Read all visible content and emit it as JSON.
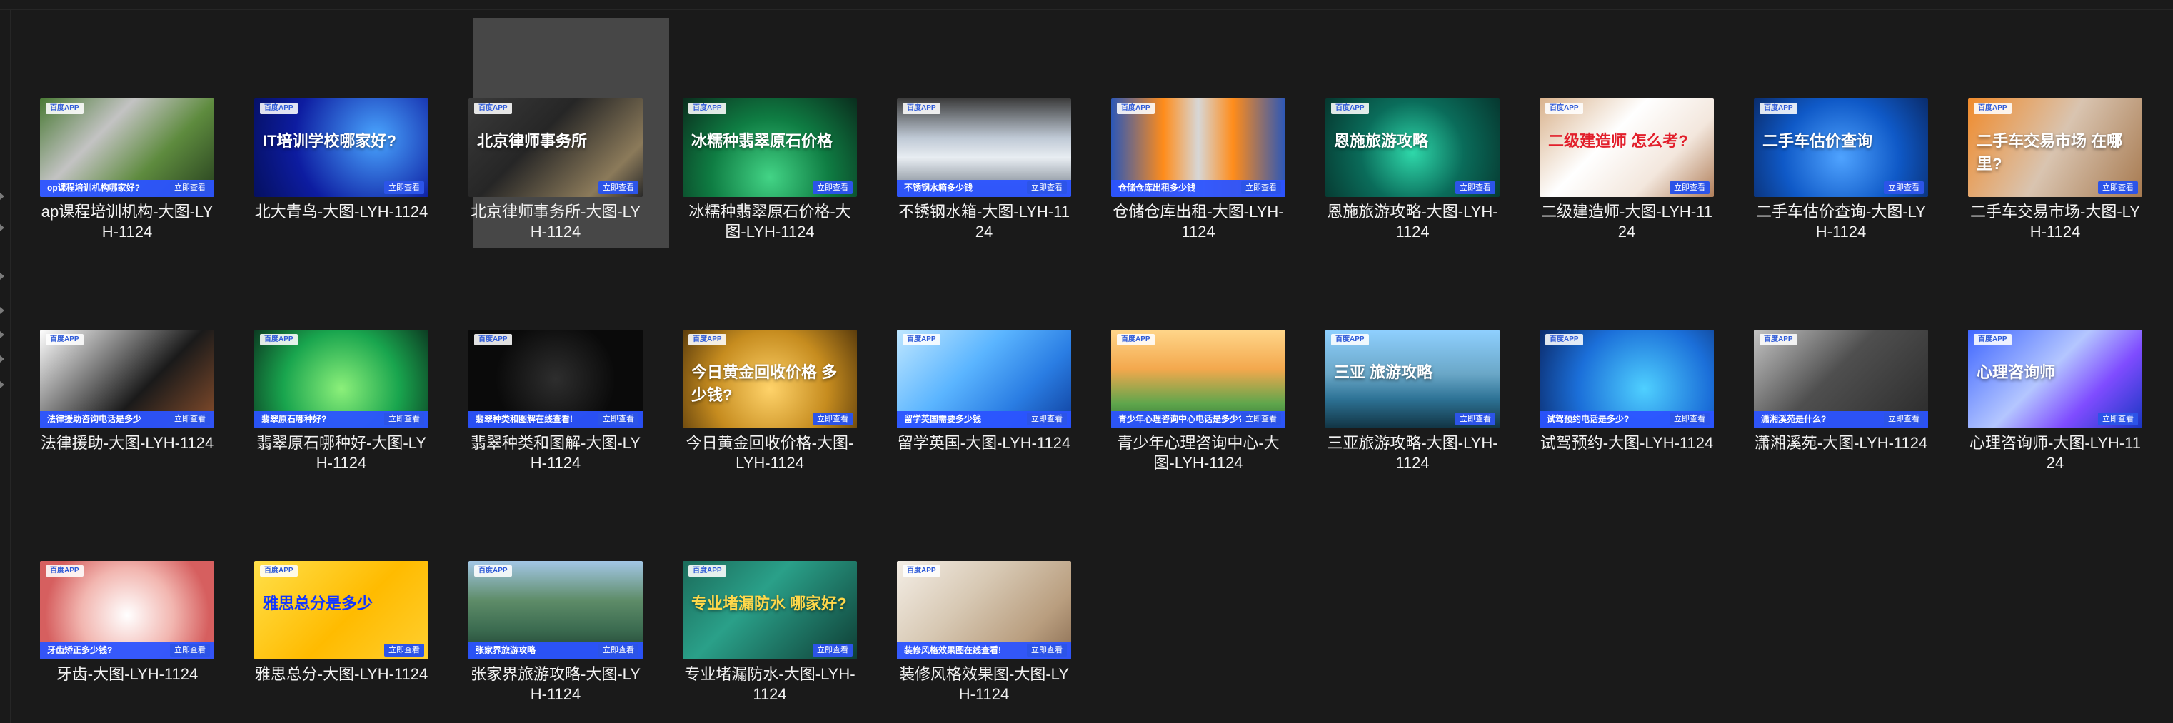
{
  "items": [
    {
      "label": "ap课程培训机构-大图-LYH-1124",
      "thumb_text": "op课程培训机构哪家好?",
      "cta": "立即查看"
    },
    {
      "label": "北大青鸟-大图-LYH-1124",
      "thumb_text": "IT培训学校哪家好?",
      "cta": "立即查看"
    },
    {
      "label": "北京律师事务所-大图-LYH-1124",
      "thumb_text": "北京律师事务所",
      "cta": "立即查看"
    },
    {
      "label": "冰糯种翡翠原石价格-大图-LYH-1124",
      "thumb_text": "冰糯种翡翠原石价格",
      "cta": "立即查看"
    },
    {
      "label": "不锈钢水箱-大图-LYH-1124",
      "thumb_text": "不锈钢水箱多少钱",
      "cta": "立即查看"
    },
    {
      "label": "仓储仓库出租-大图-LYH-1124",
      "thumb_text": "仓储仓库出租多少钱",
      "cta": "立即查看"
    },
    {
      "label": "恩施旅游攻略-大图-LYH-1124",
      "thumb_text": "恩施旅游攻略",
      "cta": "立即查看"
    },
    {
      "label": "二级建造师-大图-LYH-1124",
      "thumb_text": "二级建造师 怎么考?",
      "cta": "立即查看"
    },
    {
      "label": "二手车估价查询-大图-LYH-1124",
      "thumb_text": "二手车估价查询",
      "cta": "立即查看"
    },
    {
      "label": "二手车交易市场-大图-LYH-1124",
      "thumb_text": "二手车交易市场 在哪里?",
      "cta": "立即查看"
    },
    {
      "label": "法律援助-大图-LYH-1124",
      "thumb_text": "法律援助咨询电话是多少",
      "cta": "立即查看"
    },
    {
      "label": "翡翠原石哪种好-大图-LYH-1124",
      "thumb_text": "翡翠原石哪种好?",
      "cta": "立即查看"
    },
    {
      "label": "翡翠种类和图解-大图-LYH-1124",
      "thumb_text": "翡翠种类和图解在线查看!",
      "cta": "立即查看"
    },
    {
      "label": "今日黄金回收价格-大图-LYH-1124",
      "thumb_text": "今日黄金回收价格 多少钱?",
      "cta": "立即查看"
    },
    {
      "label": "留学英国-大图-LYH-1124",
      "thumb_text": "留学英国需要多少钱",
      "cta": "立即查看"
    },
    {
      "label": "青少年心理咨询中心-大图-LYH-1124",
      "thumb_text": "青少年心理咨询中心电话是多少?",
      "cta": "立即查看"
    },
    {
      "label": "三亚旅游攻略-大图-LYH-1124",
      "thumb_text": "三亚 旅游攻略",
      "cta": "立即查看"
    },
    {
      "label": "试驾预约-大图-LYH-1124",
      "thumb_text": "试驾预约电话是多少?",
      "cta": "立即查看"
    },
    {
      "label": "潇湘溪苑-大图-LYH-1124",
      "thumb_text": "潇湘溪苑是什么?",
      "cta": "立即查看"
    },
    {
      "label": "心理咨询师-大图-LYH-1124",
      "thumb_text": "心理咨询师",
      "cta": "立即查看"
    },
    {
      "label": "牙齿-大图-LYH-1124",
      "thumb_text": "牙齿矫正多少钱?",
      "cta": "立即查看"
    },
    {
      "label": "雅思总分-大图-LYH-1124",
      "thumb_text": "雅思总分是多少",
      "cta": "立即查看"
    },
    {
      "label": "张家界旅游攻略-大图-LYH-1124",
      "thumb_text": "张家界旅游攻略",
      "cta": "立即查看"
    },
    {
      "label": "专业堵漏防水-大图-LYH-1124",
      "thumb_text": "专业堵漏防水 哪家好?",
      "cta": "立即查看"
    },
    {
      "label": "装修风格效果图-大图-LYH-1124",
      "thumb_text": "装修风格效果图在线查看!",
      "cta": "立即查看"
    }
  ],
  "badge": "百度APP"
}
